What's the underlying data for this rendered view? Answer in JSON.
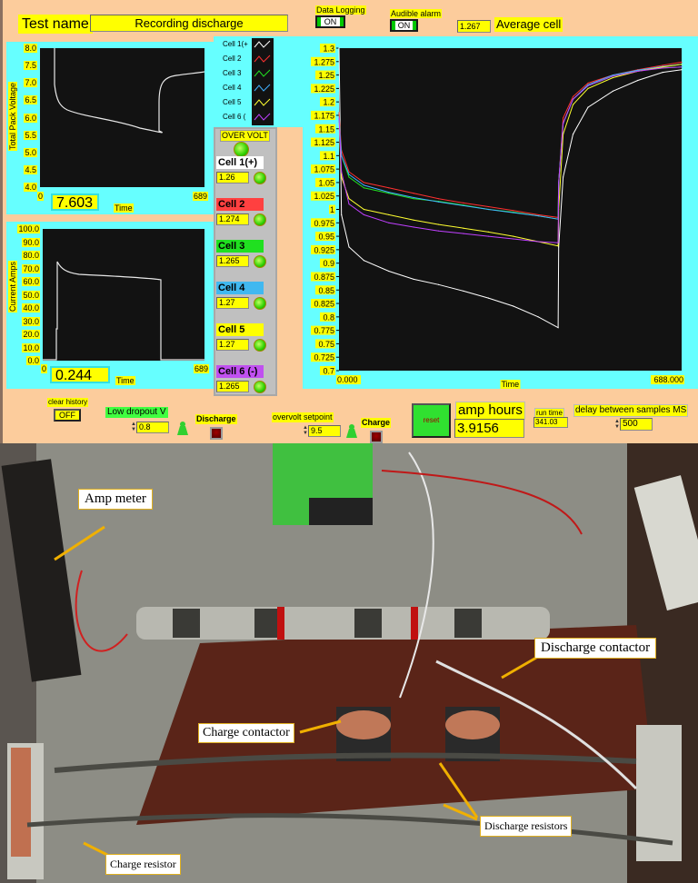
{
  "header": {
    "test_name_label": "Test name",
    "test_name_value": "Recording discharge",
    "data_logging_label": "Data Logging",
    "data_logging_state": "ON",
    "audible_alarm_label": "Audible alarm",
    "audible_alarm_state": "ON",
    "average_cell_value": "1.267",
    "average_cell_label": "Average cell"
  },
  "pack_voltage_chart": {
    "ylabel": "Total Pack Voltage",
    "xlabel": "Time",
    "yticks": [
      "8.0",
      "7.5",
      "7.0",
      "6.5",
      "6.0",
      "5.5",
      "5.0",
      "4.5",
      "4.0"
    ],
    "xticks": [
      "0",
      "689"
    ],
    "readout": "7.603"
  },
  "current_chart": {
    "ylabel": "Current Amps",
    "xlabel": "Time",
    "yticks": [
      "100.0",
      "90.0",
      "80.0",
      "70.0",
      "60.0",
      "50.0",
      "40.0",
      "30.0",
      "20.0",
      "10.0",
      "0.0"
    ],
    "xticks": [
      "0",
      "689"
    ],
    "readout": "0.244"
  },
  "legend": [
    {
      "label": "Cell 1(+",
      "color": "#ffffff"
    },
    {
      "label": "Cell 2",
      "color": "#ff3030"
    },
    {
      "label": "Cell 3",
      "color": "#20e020"
    },
    {
      "label": "Cell 4",
      "color": "#40b0ff"
    },
    {
      "label": "Cell 5",
      "color": "#ffff30"
    },
    {
      "label": "Cell 6 (",
      "color": "#c040ff"
    }
  ],
  "cells_panel": {
    "over_volt_label": "OVER VOLT",
    "cells": [
      {
        "name": "Cell 1(+)",
        "value": "1.26",
        "bg": "#ffffff"
      },
      {
        "name": "Cell 2",
        "value": "1.274",
        "bg": "#ff4040"
      },
      {
        "name": "Cell 3",
        "value": "1.265",
        "bg": "#20e020"
      },
      {
        "name": "Cell 4",
        "value": "1.27",
        "bg": "#40b8f0"
      },
      {
        "name": "Cell 5",
        "value": "1.27",
        "bg": "#ffff00"
      },
      {
        "name": "Cell 6 (-)",
        "value": "1.265",
        "bg": "#c050f0"
      }
    ]
  },
  "chart_data": {
    "type": "line",
    "title": "",
    "xlabel": "Time",
    "ylabel": "",
    "xlim": [
      0,
      688
    ],
    "ylim": [
      0.7,
      1.3
    ],
    "xtick_labels": [
      "0.000",
      "688.000"
    ],
    "ytick_labels": [
      "1.3",
      "1.275",
      "1.25",
      "1.225",
      "1.2",
      "1.175",
      "1.15",
      "1.125",
      "1.1",
      "1.075",
      "1.05",
      "1.025",
      "1",
      "0.975",
      "0.95",
      "0.925",
      "0.9",
      "0.875",
      "0.85",
      "0.825",
      "0.8",
      "0.775",
      "0.75",
      "0.725",
      "0.7"
    ],
    "x": [
      0,
      5,
      20,
      50,
      100,
      150,
      200,
      250,
      300,
      350,
      400,
      440,
      441,
      450,
      470,
      500,
      550,
      600,
      650,
      688
    ],
    "series": [
      {
        "name": "Cell 1(+)",
        "color": "#ffffff",
        "values": [
          1.3,
          0.99,
          0.93,
          0.905,
          0.885,
          0.87,
          0.86,
          0.848,
          0.835,
          0.82,
          0.8,
          0.78,
          0.93,
          1.06,
          1.14,
          1.19,
          1.22,
          1.24,
          1.255,
          1.26
        ]
      },
      {
        "name": "Cell 2",
        "color": "#ff3030",
        "values": [
          1.18,
          1.11,
          1.07,
          1.05,
          1.04,
          1.03,
          1.02,
          1.012,
          1.005,
          0.998,
          0.99,
          0.985,
          1.05,
          1.17,
          1.21,
          1.235,
          1.25,
          1.26,
          1.268,
          1.274
        ]
      },
      {
        "name": "Cell 3",
        "color": "#20e020",
        "values": [
          1.17,
          1.1,
          1.06,
          1.04,
          1.03,
          1.02,
          1.015,
          1.008,
          1.0,
          0.995,
          0.988,
          0.982,
          1.05,
          1.16,
          1.205,
          1.23,
          1.248,
          1.258,
          1.263,
          1.265
        ]
      },
      {
        "name": "Cell 4",
        "color": "#40b0ff",
        "values": [
          1.17,
          1.1,
          1.065,
          1.045,
          1.032,
          1.022,
          1.014,
          1.007,
          1.0,
          0.994,
          0.988,
          0.982,
          1.05,
          1.16,
          1.205,
          1.232,
          1.25,
          1.259,
          1.266,
          1.27
        ]
      },
      {
        "name": "Cell 5",
        "color": "#ffff30",
        "values": [
          1.16,
          1.06,
          1.02,
          1.0,
          0.99,
          0.98,
          0.972,
          0.965,
          0.958,
          0.95,
          0.94,
          0.932,
          1.0,
          1.14,
          1.195,
          1.225,
          1.245,
          1.257,
          1.265,
          1.27
        ]
      },
      {
        "name": "Cell 6 (-)",
        "color": "#c040ff",
        "values": [
          1.17,
          1.07,
          1.01,
          0.99,
          0.975,
          0.967,
          0.96,
          0.955,
          0.95,
          0.945,
          0.94,
          0.938,
          1.05,
          1.16,
          1.205,
          1.23,
          1.248,
          1.257,
          1.263,
          1.265
        ]
      }
    ],
    "grid": false,
    "legend": "left"
  },
  "bottom_controls": {
    "clear_history_label": "clear history",
    "clear_history_state": "OFF",
    "low_dropout_label": "Low dropout V",
    "low_dropout_value": "0.8",
    "discharge_label": "Discharge",
    "overvolt_label": "overvolt setpoint",
    "overvolt_value": "9.5",
    "charge_label": "Charge",
    "reset_label": "reset",
    "amp_hours_label": "amp hours",
    "amp_hours_value": "3.9156",
    "run_time_label": "run time",
    "run_time_value": "341.03",
    "delay_label": "delay between samples MS",
    "delay_value": "500"
  },
  "photo": {
    "callouts": {
      "amp_meter": "Amp meter",
      "discharge_contactor": "Discharge contactor",
      "charge_contactor": "Charge contactor",
      "discharge_resistors": "Discharge resistors",
      "charge_resistor": "Charge resistor"
    }
  }
}
